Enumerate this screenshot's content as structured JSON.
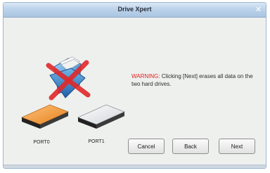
{
  "window": {
    "title": "Drive Xpert",
    "close_glyph": "✕"
  },
  "icons": {
    "main": "folder-with-red-x-icon",
    "port0": "hard-drive-orange-icon",
    "port1": "hard-drive-white-icon"
  },
  "warning": {
    "label": "WARNING:",
    "text": " Clicking [Next] erases all data on the two hard drives."
  },
  "ports": [
    {
      "label": "PORT0"
    },
    {
      "label": "PORT1"
    }
  ],
  "buttons": {
    "cancel": "Cancel",
    "back": "Back",
    "next": "Next"
  },
  "colors": {
    "warning": "#e31e1e",
    "drive_orange": "#f29a36",
    "title_bar": "#bcd3ea"
  }
}
